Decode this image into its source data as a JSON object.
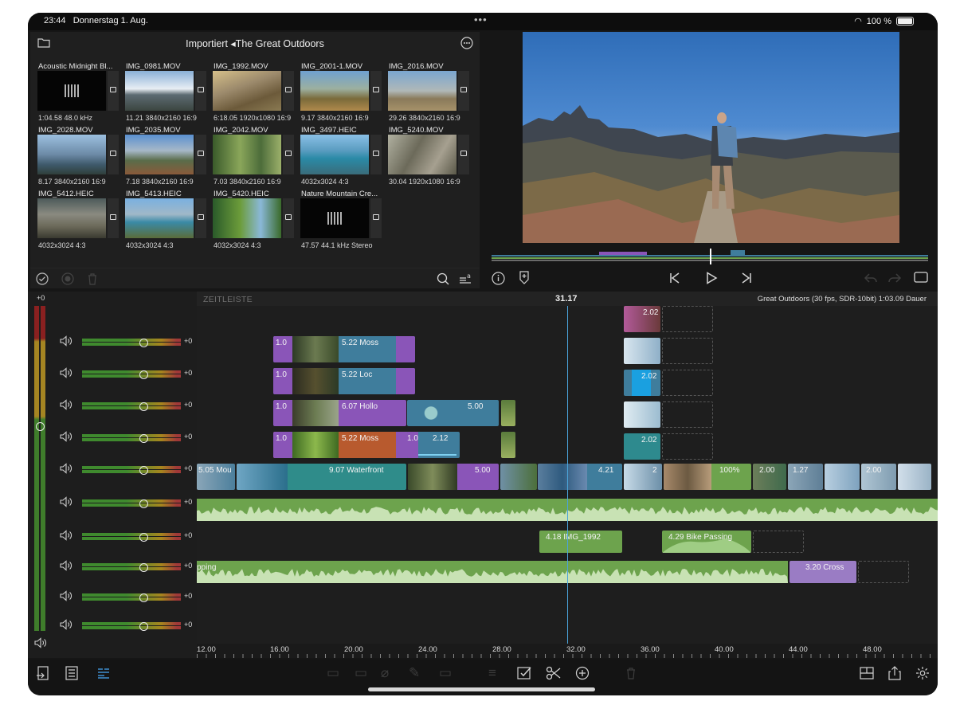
{
  "status_bar": {
    "time": "23:44",
    "date": "Donnerstag 1. Aug.",
    "battery": "100 %"
  },
  "browser": {
    "title": "Importiert ◂The Great Outdoors",
    "items": [
      {
        "name": "Acoustic Midnight Bl...",
        "meta": "1:04.58  48.0 kHz",
        "kind": "audio"
      },
      {
        "name": "IMG_0981.MOV",
        "meta": "11.21  3840x2160  16:9",
        "kind": "video"
      },
      {
        "name": "IMG_1992.MOV",
        "meta": "6:18.05  1920x1080  16:9",
        "kind": "video"
      },
      {
        "name": "IMG_2001-1.MOV",
        "meta": "9.17  3840x2160  16:9",
        "kind": "video"
      },
      {
        "name": "IMG_2016.MOV",
        "meta": "29.26  3840x2160  16:9",
        "kind": "video"
      },
      {
        "name": "IMG_2028.MOV",
        "meta": "8.17  3840x2160  16:9",
        "kind": "video"
      },
      {
        "name": "IMG_2035.MOV",
        "meta": "7.18  3840x2160  16:9",
        "kind": "video"
      },
      {
        "name": "IMG_2042.MOV",
        "meta": "7.03  3840x2160  16:9",
        "kind": "video"
      },
      {
        "name": "IMG_3497.HEIC",
        "meta": "4032x3024  4:3",
        "kind": "photo"
      },
      {
        "name": "IMG_5240.MOV",
        "meta": "30.04  1920x1080  16:9",
        "kind": "video"
      },
      {
        "name": "IMG_5412.HEIC",
        "meta": "4032x3024  4:3",
        "kind": "photo"
      },
      {
        "name": "IMG_5413.HEIC",
        "meta": "4032x3024  4:3",
        "kind": "photo"
      },
      {
        "name": "IMG_5420.HEIC",
        "meta": "4032x3024  4:3",
        "kind": "photo"
      },
      {
        "name": "Nature Mountain Cre...",
        "meta": "47.57  44.1 kHz  Stereo",
        "kind": "audio"
      }
    ]
  },
  "timeline": {
    "label": "ZEITLEISTE",
    "timecode": "31.17",
    "project_info": "Great Outdoors (30 fps, SDR-10bit)   1:03.09 Dauer",
    "master_level": "+0",
    "track_volumes": [
      "+0",
      "+0",
      "+0",
      "+0",
      "+0",
      "+0",
      "+0",
      "+0",
      "+0",
      "+0"
    ],
    "ruler": [
      "12.00",
      "16.00",
      "20.00",
      "24.00",
      "28.00",
      "32.00",
      "36.00",
      "40.00",
      "44.00",
      "48.00"
    ],
    "clips": {
      "c1": "1.0",
      "c1b": "5.22  Moss",
      "c2": "1.0",
      "c2b": "5.22  Loc",
      "c3": "1.0",
      "c3b": "6.07  Hollo",
      "c3c": "5.00",
      "c4": "1.0",
      "c4b": "5.22  Moss",
      "c4c": "1.0",
      "c4d": "2.12",
      "m1": "5.05  Mou",
      "m2": "9.07  Waterfront",
      "m3": "5.00",
      "m4": "4.21",
      "m5": "2",
      "m6": "100%",
      "m7": "2.00",
      "m8": "1.27",
      "m9": "2.00",
      "r1": "2.02",
      "r3": "2.02",
      "r5": "2.02",
      "a1": "4.18  IMG_1992",
      "a2": "4.29  Bike Passing",
      "a3": "pping",
      "a4": "3.20  Cross"
    }
  },
  "colors": {
    "video_clip": "#3f7d9c",
    "title_clip": "#8a55b8",
    "audio_clip": "#6da34d",
    "playhead": "#4aa3d9"
  }
}
